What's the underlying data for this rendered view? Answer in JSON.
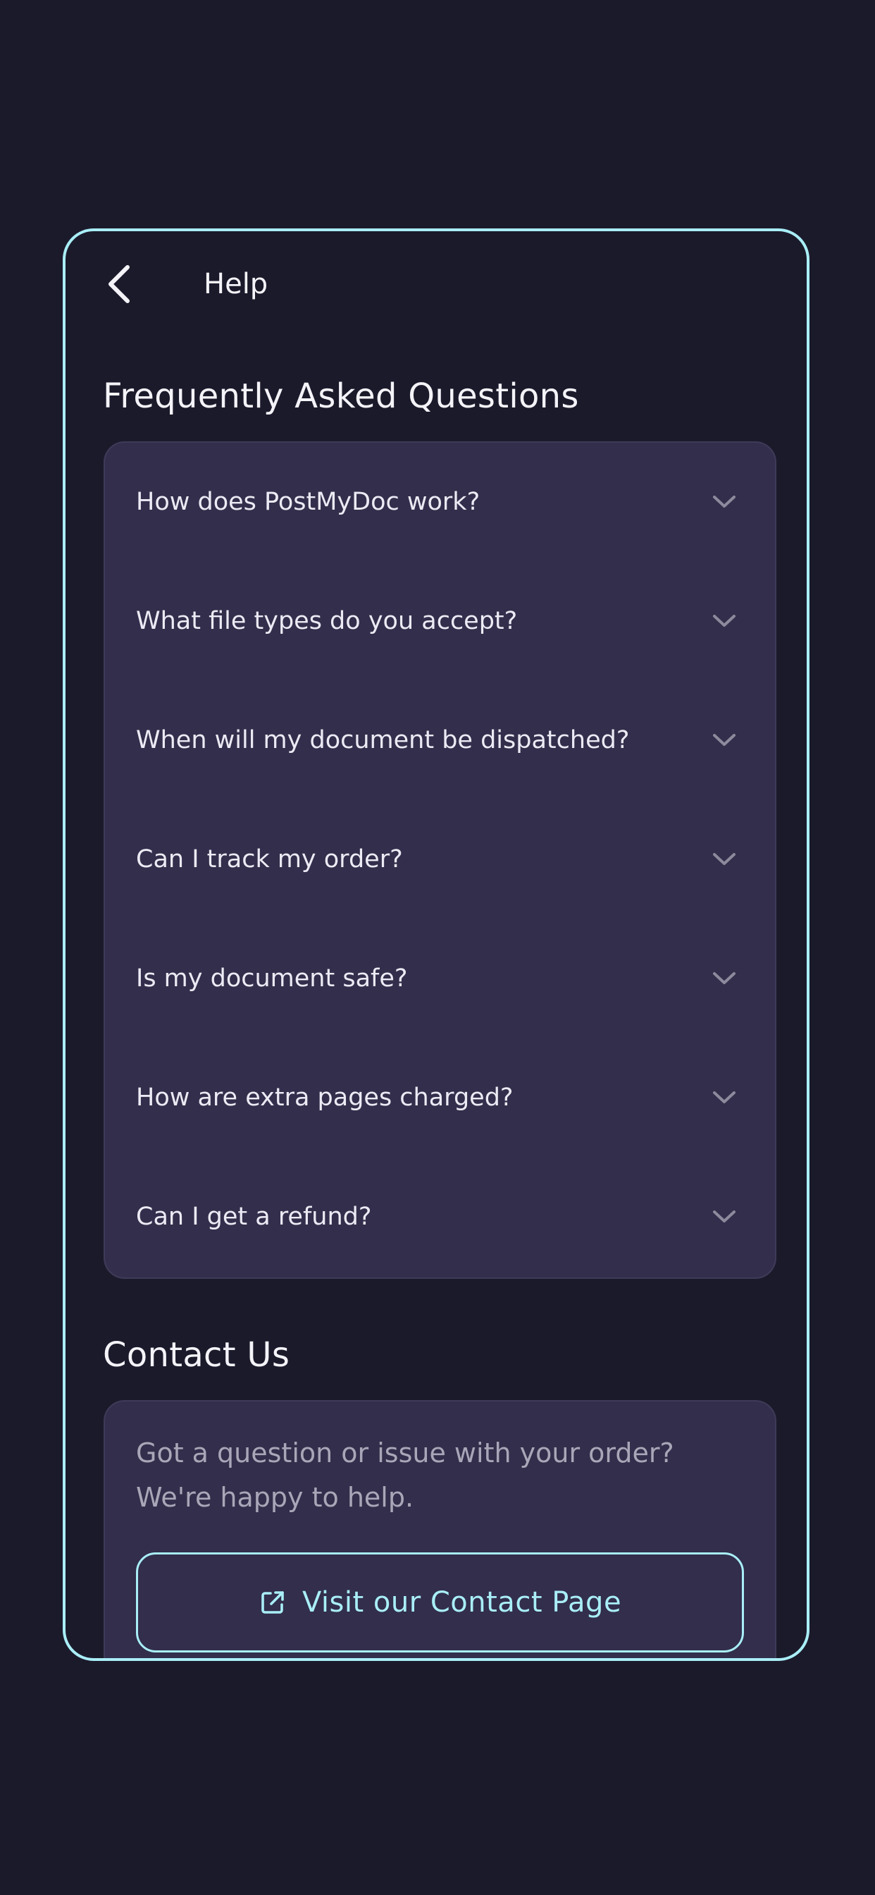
{
  "header": {
    "title": "Help",
    "back_icon": "chevron-left-icon"
  },
  "faq": {
    "title": "Frequently Asked Questions",
    "items": [
      {
        "question": "How does PostMyDoc work?",
        "expanded": false
      },
      {
        "question": "What file types do you accept?",
        "expanded": false
      },
      {
        "question": "When will my document be dispatched?",
        "expanded": false
      },
      {
        "question": "Can I track my order?",
        "expanded": false
      },
      {
        "question": "Is my document safe?",
        "expanded": false
      },
      {
        "question": "How are extra pages charged?",
        "expanded": false
      },
      {
        "question": "Can I get a refund?",
        "expanded": false
      }
    ]
  },
  "contact": {
    "title": "Contact Us",
    "text": "Got a question or issue with your order? We're happy to help.",
    "button_label": "Visit our Contact Page",
    "button_icon": "external-link-icon"
  },
  "colors": {
    "background": "#1b1a2b",
    "card": "#322e4b",
    "accent": "#a9eef7",
    "text": "#f4f3f8",
    "muted_text": "#a9a6b8"
  }
}
